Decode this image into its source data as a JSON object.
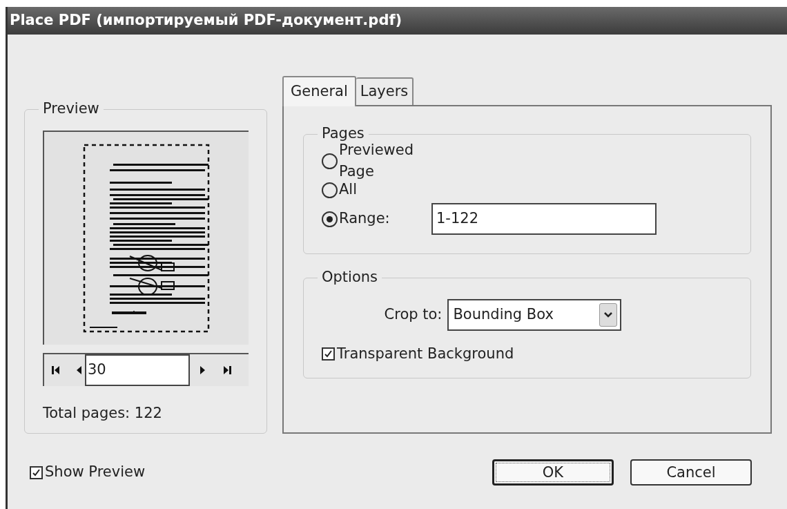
{
  "window": {
    "title": "Place PDF (импортируемый PDF-документ.pdf)"
  },
  "preview": {
    "label": "Preview",
    "page_number": "30",
    "total_pages": "Total pages: 122"
  },
  "tabs": [
    {
      "label": "General",
      "selected": true
    },
    {
      "label": "Layers",
      "selected": false
    }
  ],
  "pages": {
    "label": "Pages",
    "options": [
      {
        "label": "Previewed Page",
        "selected": false
      },
      {
        "label": "All",
        "selected": false
      },
      {
        "label": "Range:",
        "selected": true
      }
    ],
    "range_value": "1-122"
  },
  "options": {
    "label": "Options",
    "crop_label": "Crop to:",
    "crop_value": "Bounding Box",
    "transparent_background": {
      "label": "Transparent Background",
      "checked": true
    }
  },
  "show_preview": {
    "label": "Show Preview",
    "checked": true
  },
  "buttons": [
    {
      "label": "OK",
      "kind": "default"
    },
    {
      "label": "Cancel",
      "kind": "normal"
    }
  ]
}
